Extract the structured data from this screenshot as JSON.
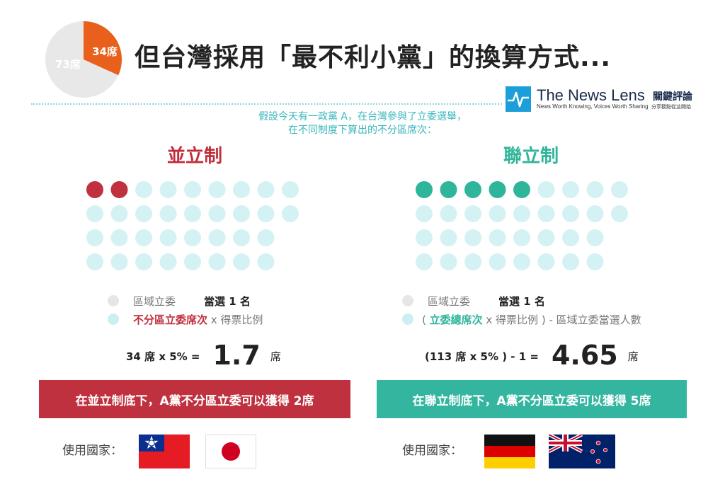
{
  "header": {
    "title": "但台灣採用「最不利小黨」的換算方式...",
    "pie": {
      "slices": [
        {
          "label": "34席",
          "value": 34,
          "color": "#e8601c"
        },
        {
          "label": "73席",
          "value": 73,
          "color": "#e8e8e8"
        }
      ]
    }
  },
  "logo": {
    "name": "The News Lens",
    "name_zh": "關鍵評論",
    "tagline": "News Worth Knowing, Voices Worth Sharing",
    "tagline_zh": "分享觀點從這開始"
  },
  "intro": {
    "line1": "假設今天有一政黨 A，在台灣參與了立委選舉，",
    "line2": "在不同制度下算出的不分區席次："
  },
  "colors": {
    "red": "#c02e3c",
    "teal": "#2fb59a",
    "light_dot": "#d4f2f3",
    "gray_dot": "#e6e6e6"
  },
  "left": {
    "title": "並立制",
    "dots": {
      "rows": [
        9,
        9,
        8,
        8
      ],
      "filled": 2,
      "fill_color": "#c0313f"
    },
    "legend": {
      "row1": {
        "label": "區域立委",
        "value": "當選 1 名"
      },
      "row2": {
        "highlight": "不分區立委席次",
        "rest": " x 得票比例"
      }
    },
    "calc": {
      "formula": "34 席 x 5% =",
      "result": "1.7",
      "unit": "席"
    },
    "banner": "在並立制底下，A黨不分區立委可以獲得 2席",
    "countries_label": "使用國家：",
    "flags": [
      "taiwan-flag",
      "japan-flag"
    ]
  },
  "right": {
    "title": "聯立制",
    "dots": {
      "rows": [
        9,
        9,
        8,
        8
      ],
      "filled": 5,
      "fill_color": "#2fb59a"
    },
    "legend": {
      "row1": {
        "label": "區域立委",
        "value": "當選 1 名"
      },
      "row2": {
        "open": "( ",
        "highlight": "立委總席次",
        "rest": " x 得票比例 ) - 區域立委當選人數"
      }
    },
    "calc": {
      "formula": "(113 席 x 5% ) - 1 =",
      "result": "4.65",
      "unit": "席"
    },
    "banner": "在聯立制底下，A黨不分區立委可以獲得 5席",
    "countries_label": "使用國家：",
    "flags": [
      "germany-flag",
      "new-zealand-flag"
    ]
  }
}
